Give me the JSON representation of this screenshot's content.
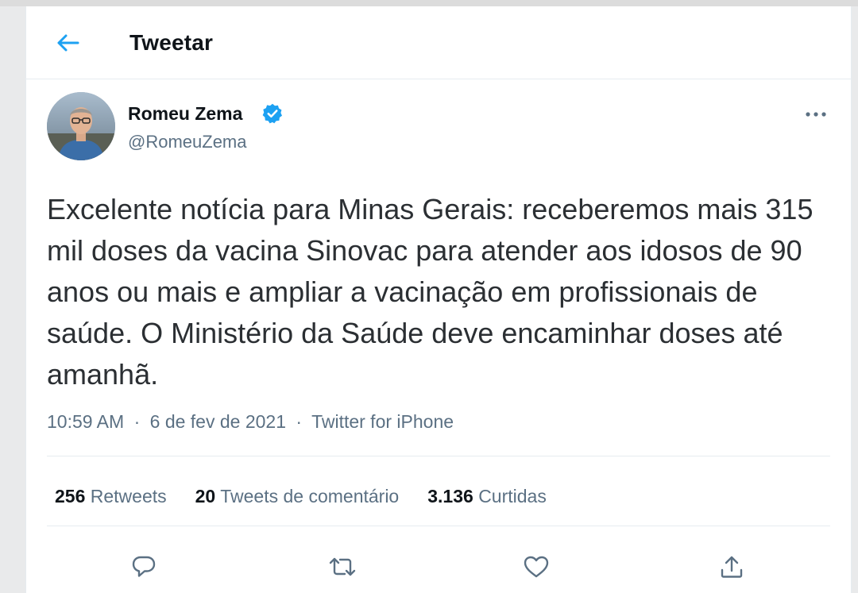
{
  "header": {
    "back_icon": "arrow-left-icon",
    "title": "Tweetar"
  },
  "tweet": {
    "author": {
      "name": "Romeu Zema",
      "handle": "@RomeuZema",
      "verified": true
    },
    "text": "Excelente notícia para Minas Gerais: receberemos mais 315 mil doses da vacina Sinovac para atender aos idosos de 90 anos ou mais e ampliar a vacinação em profissionais de saúde. O Ministério da Saúde deve encaminhar doses até amanhã.",
    "time": "10:59 AM",
    "date": "6 de fev de 2021",
    "separator": "·",
    "source": "Twitter for iPhone"
  },
  "stats": {
    "retweets_count": "256",
    "retweets_label": "Retweets",
    "quotes_count": "20",
    "quotes_label": "Tweets de comentário",
    "likes_count": "3.136",
    "likes_label": "Curtidas"
  },
  "actions": [
    "reply-icon",
    "retweet-icon",
    "like-icon",
    "share-icon"
  ],
  "colors": {
    "accent": "#1da1f2",
    "text_primary": "#0f1419",
    "text_secondary": "#5b7083",
    "divider": "#e6ecf0"
  }
}
